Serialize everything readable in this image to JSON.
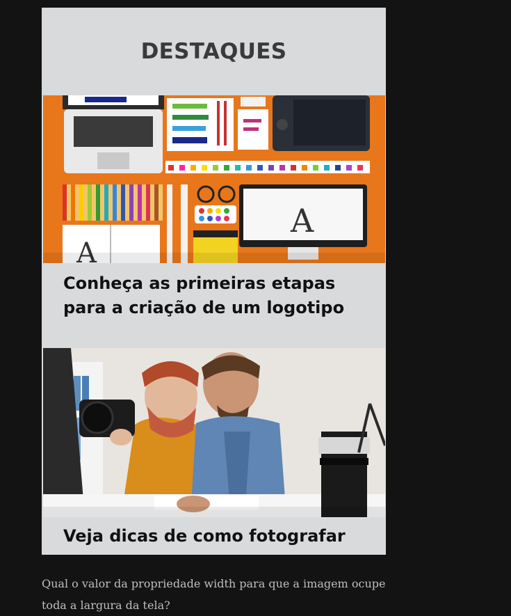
{
  "section": {
    "title": "DESTAQUES"
  },
  "articles": [
    {
      "headline": "Conheça as primeiras etapas para a criação de um logotipo",
      "image_icon": "designer-desk-flatlay-illustration"
    },
    {
      "headline": "Veja dicas de como fotografar",
      "image_icon": "photographers-with-camera-photo"
    }
  ],
  "question": {
    "text": "Qual o valor da propriedade width para que a imagem ocupe toda a largura da tela?"
  },
  "colors": {
    "page_bg": "#131313",
    "card_bg": "#d8dadc",
    "title_text": "#3a3a3a",
    "headline_text": "#111111",
    "body_text": "#bfbfbf",
    "illustration_orange": "#e8761b"
  }
}
